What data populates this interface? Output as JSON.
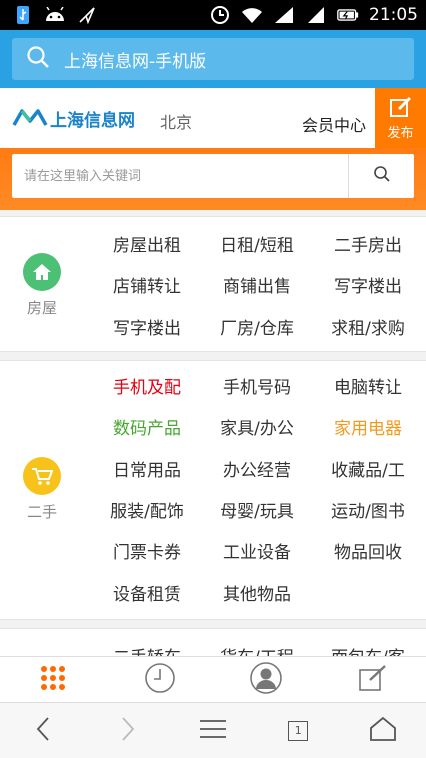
{
  "status": {
    "time": "21:05"
  },
  "address": {
    "title": "上海信息网-手机版"
  },
  "header": {
    "logo_text": "上海信息网",
    "city": "北京",
    "member": "会员中心",
    "publish": "发布"
  },
  "search": {
    "placeholder": "请在这里输入关键词"
  },
  "sections": [
    {
      "name": "房屋",
      "icon": "house-icon",
      "color": "#4cc074",
      "items": [
        "房屋出租",
        "日租/短租",
        "二手房出",
        "店铺转让",
        "商铺出售",
        "写字楼出",
        "写字楼出",
        "厂房/仓库",
        "求租/求购"
      ]
    },
    {
      "name": "二手",
      "icon": "cart-icon",
      "color": "#f7c21a",
      "items": [
        "手机及配",
        "手机号码",
        "电脑转让",
        "数码产品",
        "家具/办公",
        "家用电器",
        "日常用品",
        "办公经营",
        "收藏品/工",
        "服装/配饰",
        "母婴/玩具",
        "运动/图书",
        "门票卡券",
        "工业设备",
        "物品回收",
        "设备租赁",
        "其他物品"
      ]
    },
    {
      "items": [
        "二手轿车",
        "货车/工程",
        "面包车/客"
      ]
    }
  ],
  "colors": {
    "accent_blue": "#29a1e3",
    "accent_orange": "#ff7a00",
    "hot_red": "#e60012",
    "green": "#47a630",
    "orange": "#f39a1e"
  },
  "browser": {
    "tab_count": "1"
  }
}
